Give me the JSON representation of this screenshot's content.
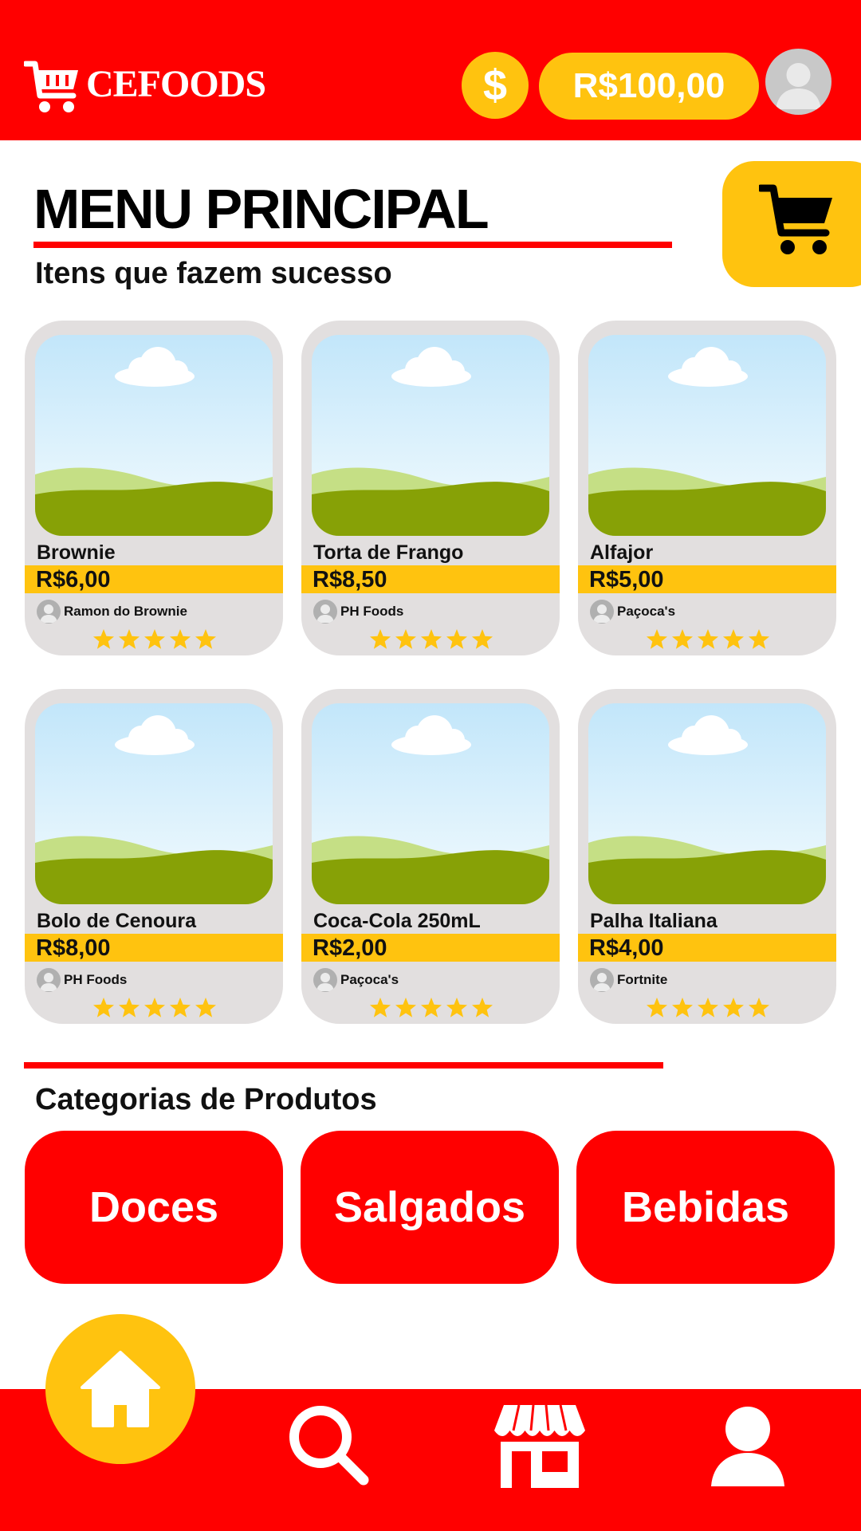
{
  "app": {
    "brand": "CEFOODS",
    "currency_symbol": "$",
    "balance": "R$100,00"
  },
  "colors": {
    "primary": "#FF0000",
    "accent": "#FFC30F",
    "card_bg": "#E2DFDF",
    "star": "#FFC30F"
  },
  "main": {
    "title": "MENU PRINCIPAL",
    "subtitle": "Itens que fazem sucesso"
  },
  "products": [
    {
      "name": "Brownie",
      "price": "R$6,00",
      "seller": "Ramon do Brownie",
      "rating": 5
    },
    {
      "name": "Torta de Frango",
      "price": "R$8,50",
      "seller": "PH Foods",
      "rating": 5
    },
    {
      "name": "Alfajor",
      "price": "R$5,00",
      "seller": "Paçoca's",
      "rating": 5
    },
    {
      "name": "Bolo de Cenoura",
      "price": "R$8,00",
      "seller": "PH Foods",
      "rating": 5
    },
    {
      "name": "Coca-Cola 250mL",
      "price": "R$2,00",
      "seller": "Paçoca's",
      "rating": 5
    },
    {
      "name": "Palha Italiana",
      "price": "R$4,00",
      "seller": "Fortnite",
      "rating": 5
    }
  ],
  "categories": {
    "heading": "Categorias de Produtos",
    "items": [
      "Doces",
      "Salgados",
      "Bebidas"
    ]
  },
  "icons": {
    "logo": "shopping-cart-icon",
    "coin": "dollar-icon",
    "profile": "avatar-icon",
    "cart": "cart-icon",
    "nav": [
      "home-icon",
      "search-icon",
      "store-icon",
      "user-icon"
    ]
  }
}
